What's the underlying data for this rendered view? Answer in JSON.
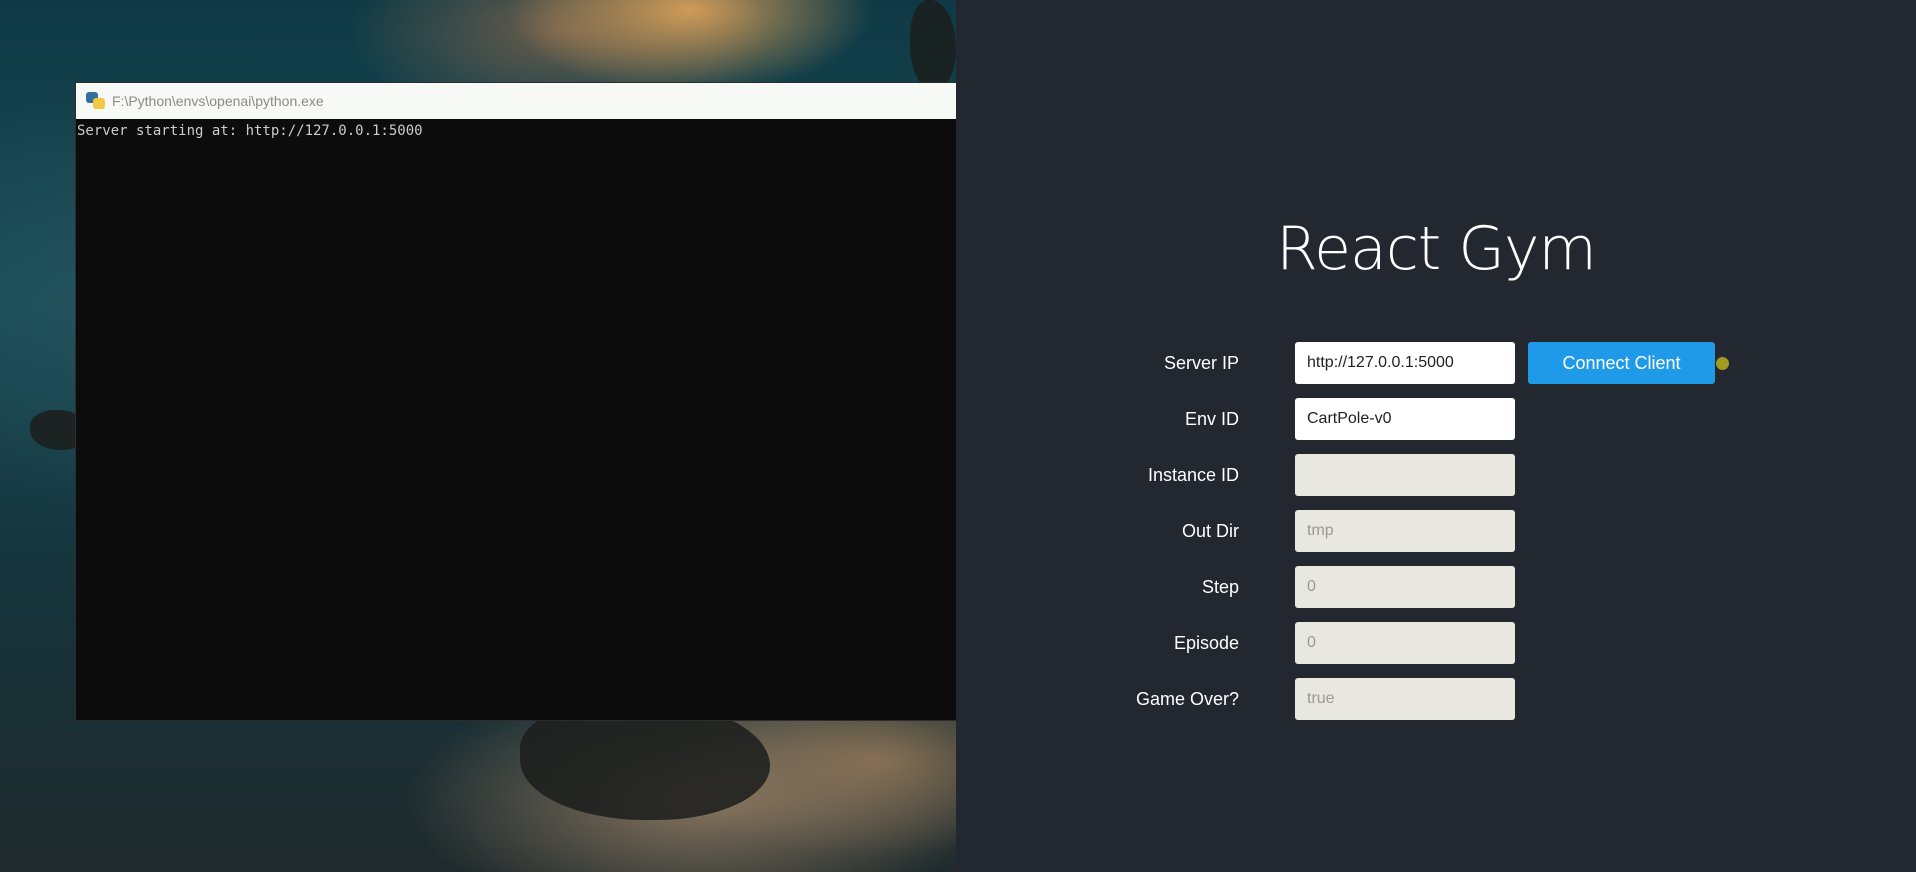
{
  "terminal": {
    "title": "F:\\Python\\envs\\openai\\python.exe",
    "output": "Server starting at: http://127.0.0.1:5000"
  },
  "app": {
    "title": "React Gym",
    "fields": {
      "server_ip": {
        "label": "Server IP",
        "value": "http://127.0.0.1:5000"
      },
      "env_id": {
        "label": "Env ID",
        "value": "CartPole-v0"
      },
      "instance_id": {
        "label": "Instance ID",
        "value": ""
      },
      "out_dir": {
        "label": "Out Dir",
        "value": "tmp"
      },
      "step": {
        "label": "Step",
        "value": "0"
      },
      "episode": {
        "label": "Episode",
        "value": "0"
      },
      "game_over": {
        "label": "Game Over?",
        "value": "true"
      }
    },
    "connect_button_label": "Connect Client",
    "status_color": "#a09c1e"
  },
  "colors": {
    "app_background": "#23272f",
    "button": "#1f9ae8",
    "terminal_background": "#0c0c0c"
  }
}
